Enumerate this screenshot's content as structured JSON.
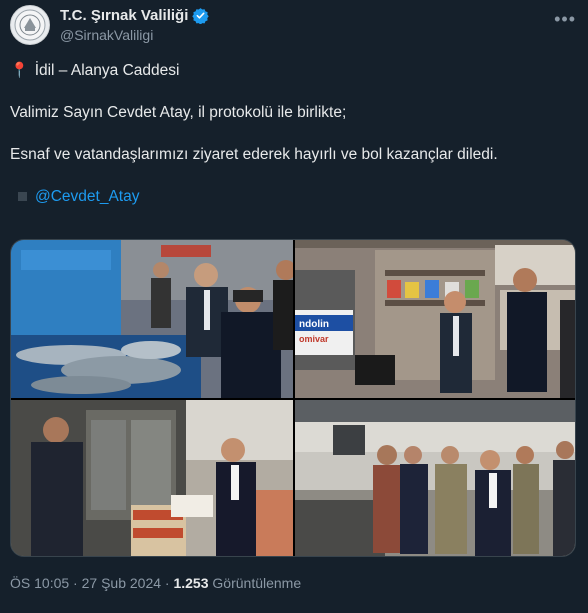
{
  "account": {
    "display_name": "T.C. Şırnak Valiliği",
    "handle": "@SirnakValiligi",
    "verified_color": "#1d9bf0"
  },
  "tweet": {
    "location_line": "İdil – Alanya Caddesi",
    "paragraph1": "Valimiz Sayın Cevdet Atay, il protokolü ile birlikte;",
    "paragraph2": "Esnaf ve vatandaşlarımızı ziyaret ederek hayırlı ve bol kazançlar diledi.",
    "mention": "@Cevdet_Atay"
  },
  "photos": {
    "p2_sign": "ndolin",
    "p2_sign2": "omivar"
  },
  "meta": {
    "time": "ÖS 10:05",
    "separator": "·",
    "date": "27 Şub 2024",
    "views_count": "1.253",
    "views_label": "Görüntülenme"
  },
  "colors": {
    "background": "#15202b",
    "text": "#e7e9ea",
    "secondary": "#8b98a5",
    "accent": "#1d9bf0"
  }
}
